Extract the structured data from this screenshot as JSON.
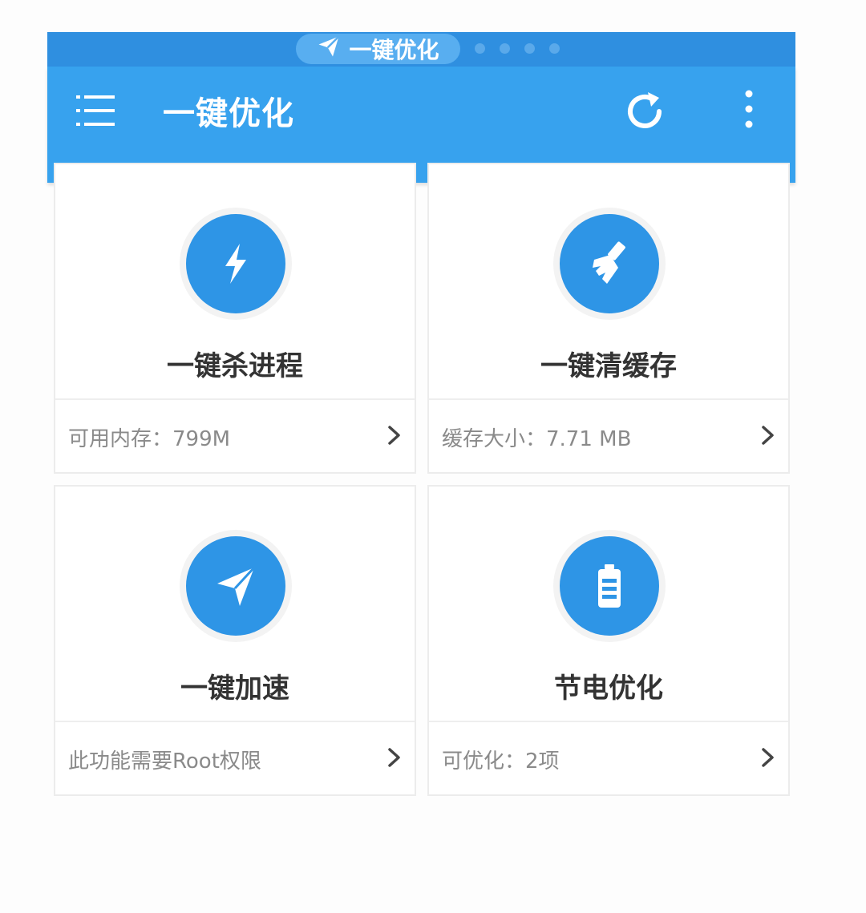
{
  "status_bar": {
    "pill_label": "一键优化",
    "pill_icon": "send-icon",
    "page_dots": 4
  },
  "app_bar": {
    "title": "一键优化",
    "menu_icon": "menu-icon",
    "refresh_icon": "refresh-icon",
    "more_icon": "more-vertical-icon",
    "color": "#37a2ee"
  },
  "accent_color": "#2e95e6",
  "cards": [
    {
      "title": "一键杀进程",
      "info": "可用内存：799M",
      "icon": "lightning-icon"
    },
    {
      "title": "一键清缓存",
      "info": "缓存大小：7.71 MB",
      "icon": "broom-icon"
    },
    {
      "title": "一键加速",
      "info": "此功能需要Root权限",
      "icon": "paper-plane-icon"
    },
    {
      "title": "节电优化",
      "info": "可优化：2项",
      "icon": "battery-icon"
    }
  ]
}
